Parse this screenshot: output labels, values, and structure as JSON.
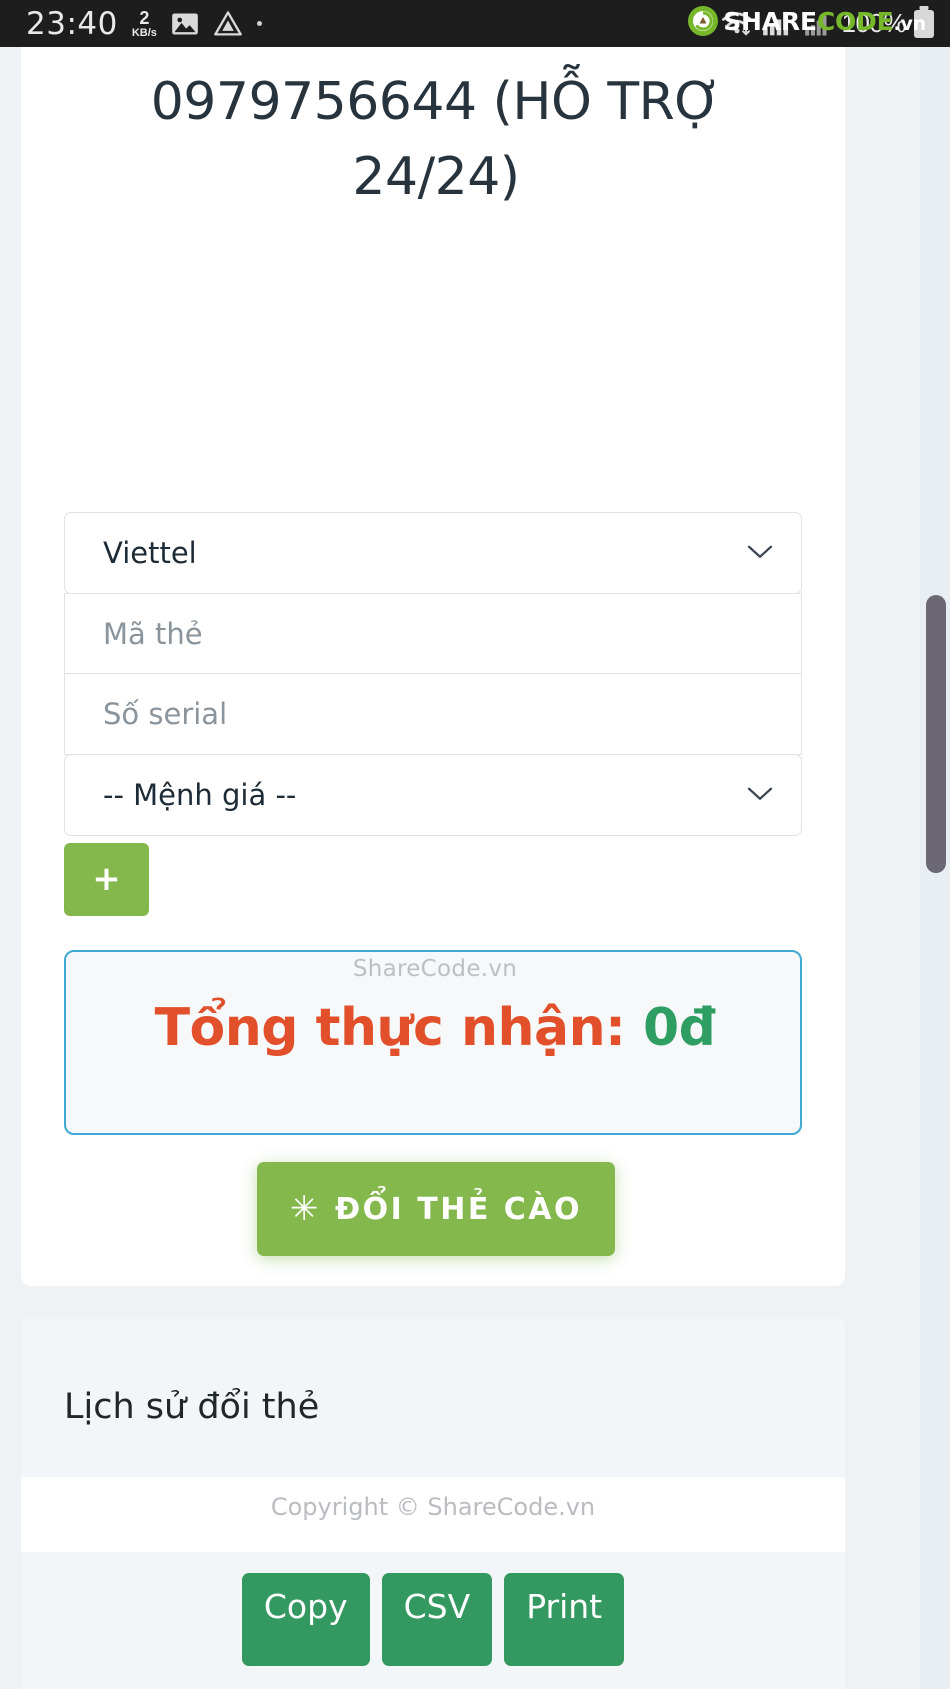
{
  "statusbar": {
    "time": "23:40",
    "net_speed_value": "2",
    "net_speed_unit": "KB/s",
    "battery_text": "100%",
    "icons": [
      "gallery-icon",
      "drive-icon",
      "dot-icon",
      "wifi-icon",
      "signal-icon"
    ],
    "watermark": {
      "share": "SHARE",
      "code": "CODE",
      "vn": ".vn"
    }
  },
  "main": {
    "page_title": "0979756644 (HỖ TRỢ 24/24)",
    "form": {
      "network_value": "Viettel",
      "card_code_placeholder": "Mã thẻ",
      "card_code_value": "",
      "serial_placeholder": "Số serial",
      "serial_value": "",
      "denomination_value": "-- Mệnh giá --",
      "add_button_label": "+"
    },
    "total": {
      "watermark": "ShareCode.vn",
      "label": "Tổng thực nhận:",
      "amount": "0đ"
    },
    "submit": {
      "star": "✳",
      "label": "ĐỔI THẺ CÀO"
    }
  },
  "history": {
    "title": "Lịch sử đổi thẻ",
    "copyright": "Copyright © ShareCode.vn",
    "buttons": [
      {
        "label": "Copy"
      },
      {
        "label": "CSV"
      },
      {
        "label": "Print"
      }
    ]
  },
  "colors": {
    "accent_green": "#85b84c",
    "button_green": "#339960",
    "total_border_blue": "#3fa9d4",
    "total_label_orange": "#e1502a",
    "total_amount_green": "#2f9e63",
    "statusbar_bg": "#1d1d1d",
    "page_bg": "#eef2f5",
    "brand_green": "#76b82a"
  }
}
